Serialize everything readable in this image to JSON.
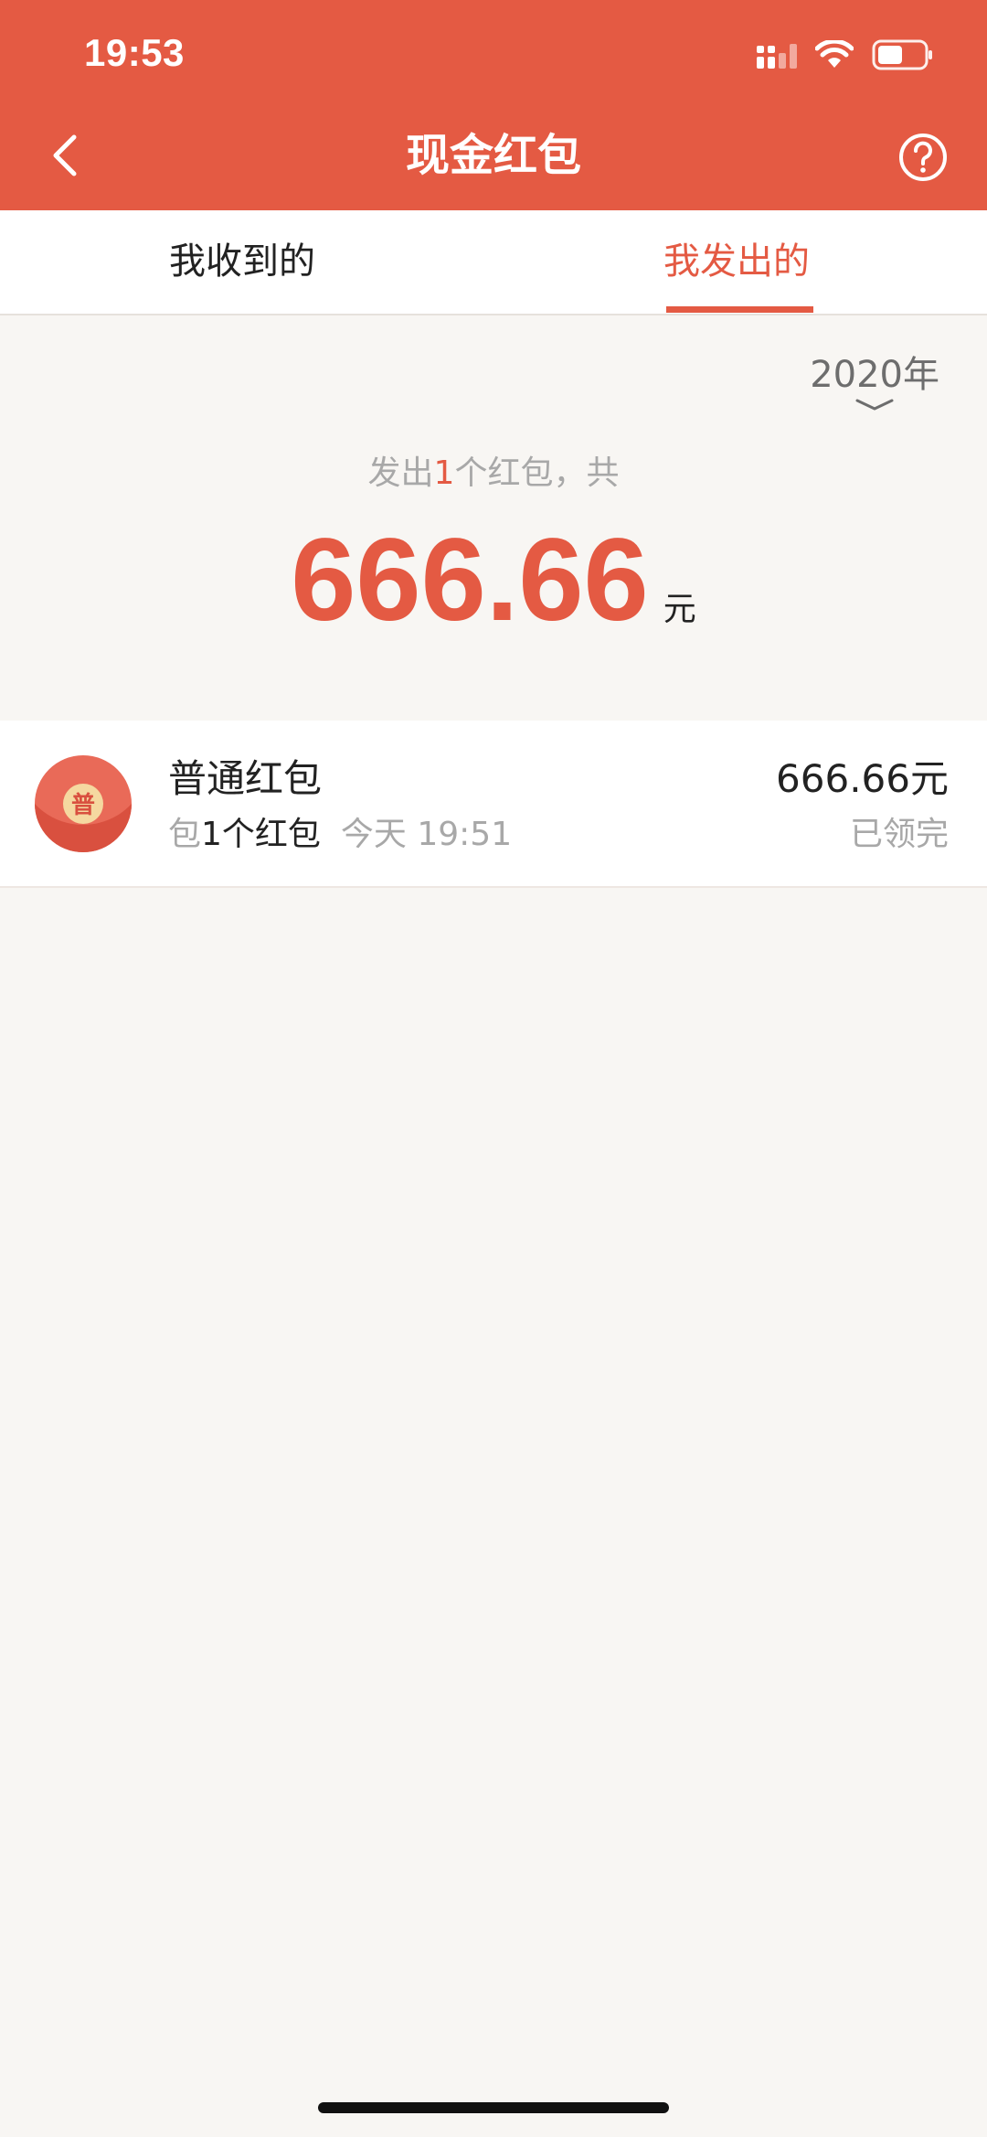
{
  "status_bar": {
    "time": "19:53"
  },
  "nav": {
    "title": "现金红包",
    "back_icon": "chevron-left-icon",
    "help_icon": "question-circle-icon"
  },
  "tabs": [
    {
      "label": "我收到的",
      "active": false
    },
    {
      "label": "我发出的",
      "active": true
    }
  ],
  "year_filter": {
    "value": "2020年",
    "icon": "chevron-down-icon"
  },
  "summary": {
    "prefix": "发出",
    "count": "1",
    "suffix": "个红包，共",
    "amount": "666.66",
    "unit": "元"
  },
  "records": [
    {
      "badge": "普",
      "title": "普通红包",
      "sub_prefix": "包",
      "sub_count": "1个红包",
      "time": "今天 19:51",
      "amount": "666.66元",
      "status": "已领完"
    }
  ],
  "colors": {
    "brand": "#E45A43",
    "background": "#F8F6F3",
    "muted_text": "#A8A8A8",
    "badge_gold": "#F5D8A0"
  }
}
